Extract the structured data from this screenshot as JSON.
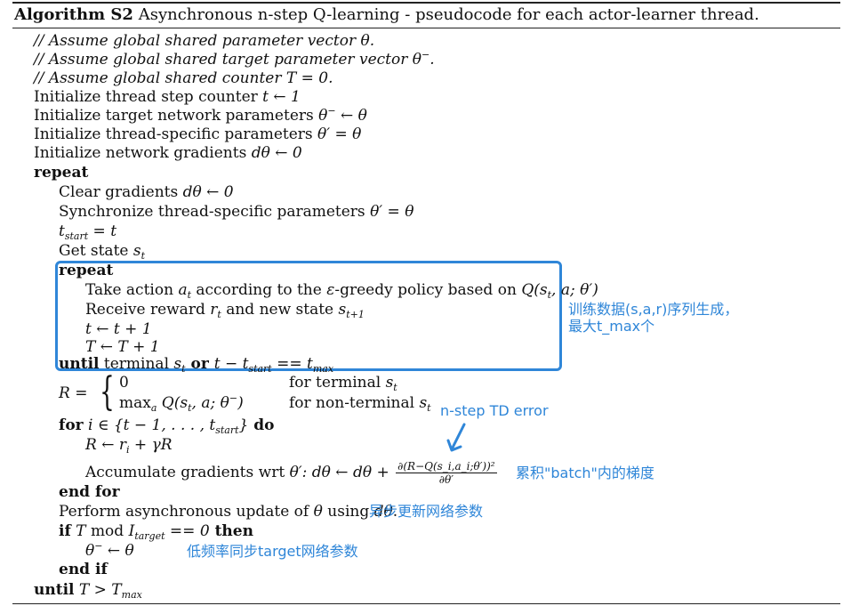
{
  "algorithm": {
    "label": "Algorithm S2",
    "title": "Asynchronous n-step Q-learning - pseudocode for each actor-learner thread."
  },
  "lines": {
    "l1": "// Assume global shared parameter vector θ.",
    "l2_a": "// Assume global shared target parameter vector θ",
    "l2_sup": "−",
    "l2_b": ".",
    "l3_a": "// Assume global shared counter ",
    "l3_m": "T = 0.",
    "l4_a": "Initialize thread step counter ",
    "l4_m": "t ← 1",
    "l5_a": "Initialize target network parameters ",
    "l5_m": "θ",
    "l5_sup": "−",
    "l5_b": " ← θ",
    "l6_a": "Initialize thread-specific parameters ",
    "l6_m": "θ′ = θ",
    "l7_a": "Initialize network gradients ",
    "l7_m": "dθ ← 0",
    "l8": "repeat",
    "l9_a": "Clear gradients ",
    "l9_m": "dθ ← 0",
    "l10_a": "Synchronize thread-specific parameters ",
    "l10_m": "θ′ = θ",
    "l11_m": "t",
    "l11_sub": "start",
    "l11_b": " = t",
    "l12_a": "Get state ",
    "l12_m": "s",
    "l12_sub": "t",
    "l13": "repeat",
    "l14_a": "Take action ",
    "l14_m": "a",
    "l14_sub": "t",
    "l14_b": " according to the ",
    "l14_eps": "ε",
    "l14_c": "-greedy policy based on ",
    "l14_q": "Q(s",
    "l14_qsub": "t",
    "l14_qend": ", a; θ′)",
    "l15_a": "Receive reward ",
    "l15_m": "r",
    "l15_sub": "t",
    "l15_b": " and new state ",
    "l15_m2": "s",
    "l15_sub2": "t+1",
    "l16_m": "t ← t + 1",
    "l17_m": "T ← T + 1",
    "l18_until": "until",
    "l18_a": " terminal ",
    "l18_m": "s",
    "l18_sub": "t",
    "l18_or": " or ",
    "l18_m2": "t − t",
    "l18_sub2": "start",
    "l18_m3": " == t",
    "l18_sub3": "max",
    "l19_r": "R =",
    "l19_c1": "0",
    "l19_c1r": "for terminal ",
    "l19_c1s": "s",
    "l19_c1sub": "t",
    "l19_c2": "max",
    "l19_c2sub": "a",
    "l19_c2b": " Q(s",
    "l19_c2sub2": "t",
    "l19_c2c": ", a; θ",
    "l19_c2sup": "−",
    "l19_c2d": ")",
    "l19_c2r": "for non-terminal ",
    "l19_c2s": "s",
    "l19_c2rsub": "t",
    "l20_for": "for",
    "l20_m": " i ∈ {t − 1, . . . , t",
    "l20_sub": "start",
    "l20_m2": "}",
    "l20_do": " do",
    "l21_m": "R ← r",
    "l21_sub": "i",
    "l21_m2": " + γR",
    "l22_a": "Accumulate gradients wrt ",
    "l22_m": "θ′: dθ ← dθ + ",
    "l22_num": "∂(R−Q(s_i,a_i;θ′))²",
    "l22_den": "∂θ′",
    "l23": "end for",
    "l24_a": "Perform asynchronous update of ",
    "l24_m": "θ",
    "l24_b": " using ",
    "l24_m2": "dθ",
    "l24_c": ".",
    "l25_if": "if",
    "l25_m": " T  ",
    "l25_mod": "mod",
    "l25_m2": " I",
    "l25_sub": "target",
    "l25_m3": " == 0",
    "l25_then": " then",
    "l26_m": "θ",
    "l26_sup": "−",
    "l26_m2": " ← θ",
    "l27": "end if",
    "l28_until": "until",
    "l28_m": " T > T",
    "l28_sub": "max"
  },
  "annotations": {
    "box_note_1": "训练数据(s,a,r)序列生成，",
    "box_note_2": "最大t_max个",
    "td_error": "n-step TD error",
    "batch_note": "累积\"batch\"内的梯度",
    "async_note": "异步更新网络参数",
    "target_note": "低频率同步target网络参数"
  },
  "colors": {
    "annotation": "#2f86d8",
    "box": "#2f86d8",
    "text": "#111111"
  }
}
